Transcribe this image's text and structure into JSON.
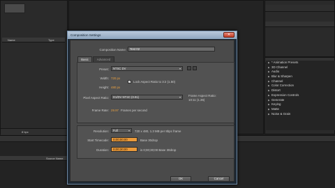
{
  "project_panel": {
    "columns": {
      "name": "Name",
      "type": "Type"
    },
    "footer": {
      "bpc": "8 bpc"
    }
  },
  "timeline_panel": {
    "columns": {
      "source_name": "Source Name"
    }
  },
  "effects_panel": {
    "items": [
      "* Animation Presets",
      "3D Channel",
      "Audio",
      "Blur & Sharpen",
      "Channel",
      "Color Correction",
      "Distort",
      "Expression Controls",
      "Generate",
      "Keying",
      "Matte",
      "Noise & Grain"
    ]
  },
  "dialog": {
    "title": "Composition Settings",
    "close_label": "✕",
    "composition_name_label": "Composition Name:",
    "composition_name_value": "Test 02",
    "tabs": [
      "Basic",
      "Advanced"
    ],
    "preset_label": "Preset:",
    "preset_value": "NTSC DV",
    "width_label": "Width:",
    "width_value": "720 px",
    "height_label": "Height:",
    "height_value": "480 px",
    "lock_aspect_label": "Lock Aspect Ratio to 3:2 (1.50)",
    "lock_aspect_checked": true,
    "pixel_aspect_label": "Pixel Aspect Ratio:",
    "pixel_aspect_value": "D1/DV NTSC (0.91)",
    "frame_aspect_label": "Frame Aspect Ratio:",
    "frame_aspect_value": "10:11 (1.36)",
    "frame_rate_label": "Frame Rate:",
    "frame_rate_value": "29.97",
    "frame_rate_unit": "Frames per second",
    "resolution_label": "Resolution:",
    "resolution_value": "Full",
    "resolution_info": "720 x 480, 1.3 MB per 8bpc frame",
    "start_timecode_label": "Start Timecode:",
    "start_timecode_value": "0;00;00;00",
    "start_timecode_note": "Base 30drop",
    "duration_label": "Duration:",
    "duration_value": "0;00;30;00",
    "duration_note": "is 0;00;30;00  Base 30drop",
    "ok_label": "OK",
    "cancel_label": "Cancel"
  }
}
